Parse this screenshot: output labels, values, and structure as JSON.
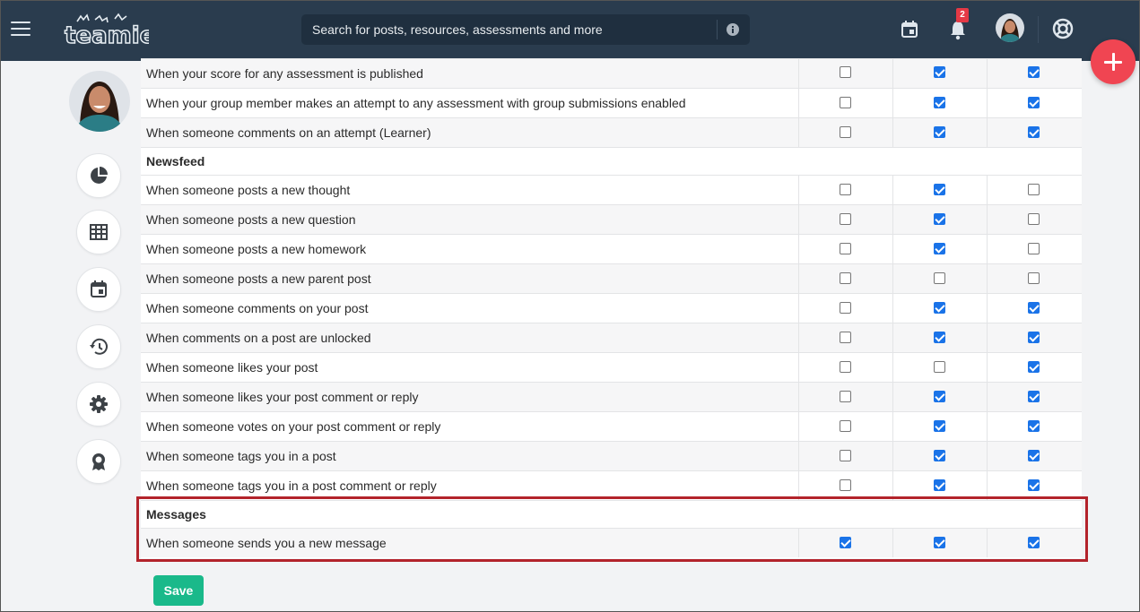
{
  "app": {
    "logo_text": "teamie"
  },
  "header": {
    "search_placeholder": "Search for posts, resources, assessments and more",
    "notification_count": "2"
  },
  "colors": {
    "topbar": "#2a3c4e",
    "accent_fab": "#f04552",
    "checkbox_checked": "#1a73e8",
    "save_button": "#1ab98a",
    "highlight_border": "#b3232b"
  },
  "rail": {
    "items": [
      {
        "icon": "pie-chart-icon"
      },
      {
        "icon": "grid-table-icon"
      },
      {
        "icon": "calendar-icon"
      },
      {
        "icon": "history-icon"
      },
      {
        "icon": "gear-icon"
      },
      {
        "icon": "award-icon"
      }
    ]
  },
  "rows": [
    {
      "type": "item",
      "label": "When your score for any assessment is published",
      "checks": [
        false,
        true,
        true
      ]
    },
    {
      "type": "item",
      "label": "When your group member makes an attempt to any assessment with group submissions enabled",
      "checks": [
        false,
        true,
        true
      ]
    },
    {
      "type": "item",
      "label": "When someone comments on an attempt (Learner)",
      "checks": [
        false,
        true,
        true
      ]
    },
    {
      "type": "section",
      "label": "Newsfeed"
    },
    {
      "type": "item",
      "label": "When someone posts a new thought",
      "checks": [
        false,
        true,
        false
      ]
    },
    {
      "type": "item",
      "label": "When someone posts a new question",
      "checks": [
        false,
        true,
        false
      ]
    },
    {
      "type": "item",
      "label": "When someone posts a new homework",
      "checks": [
        false,
        true,
        false
      ]
    },
    {
      "type": "item",
      "label": "When someone posts a new parent post",
      "checks": [
        false,
        false,
        false
      ]
    },
    {
      "type": "item",
      "label": "When someone comments on your post",
      "checks": [
        false,
        true,
        true
      ]
    },
    {
      "type": "item",
      "label": "When comments on a post are unlocked",
      "checks": [
        false,
        true,
        true
      ]
    },
    {
      "type": "item",
      "label": "When someone likes your post",
      "checks": [
        false,
        false,
        true
      ]
    },
    {
      "type": "item",
      "label": "When someone likes your post comment or reply",
      "checks": [
        false,
        true,
        true
      ]
    },
    {
      "type": "item",
      "label": "When someone votes on your post comment or reply",
      "checks": [
        false,
        true,
        true
      ]
    },
    {
      "type": "item",
      "label": "When someone tags you in a post",
      "checks": [
        false,
        true,
        true
      ]
    },
    {
      "type": "item",
      "label": "When someone tags you in a post comment or reply",
      "checks": [
        false,
        true,
        true
      ]
    },
    {
      "type": "section",
      "label": "Messages"
    },
    {
      "type": "item",
      "label": "When someone sends you a new message",
      "checks": [
        true,
        true,
        true
      ]
    }
  ],
  "actions": {
    "save_label": "Save"
  }
}
